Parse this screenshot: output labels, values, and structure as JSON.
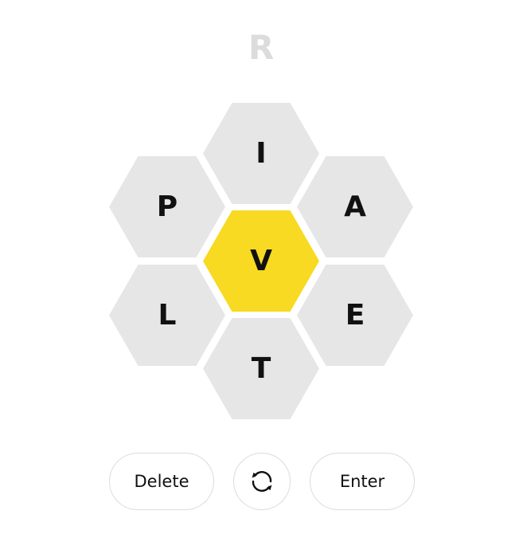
{
  "input": {
    "current_word": "R"
  },
  "hive": {
    "center_letter": "V",
    "outer_letters": {
      "top": "I",
      "upper_left": "P",
      "upper_right": "A",
      "lower_left": "L",
      "lower_right": "E",
      "bottom": "T"
    },
    "center_color": "#f7da21",
    "outer_color": "#e6e6e6"
  },
  "controls": {
    "delete_label": "Delete",
    "enter_label": "Enter",
    "shuffle_icon": "shuffle-icon"
  }
}
